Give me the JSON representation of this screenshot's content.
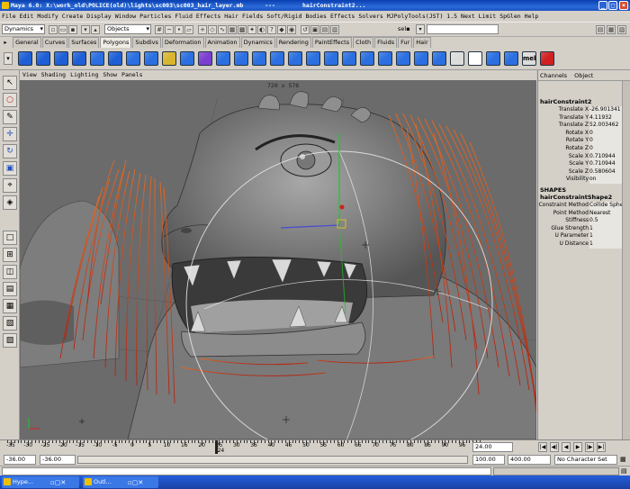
{
  "window": {
    "title": "Maya 6.0: X:\\work_old\\POLICE(old)\\lights\\sc003\\sc003_hair_layer.mb    ---    hairConstraint2...",
    "title_main": "Maya 6.0: X:\\work_old\\POLICE(old)\\lights\\sc003\\sc003_hair_layer.mb",
    "title_sep": "---",
    "title_node": "hairConstraint2..."
  },
  "menus": [
    "File",
    "Edit",
    "Modify",
    "Create",
    "Display",
    "Window",
    "Particles",
    "Fluid Effects",
    "Hair",
    "Fields",
    "Soft/Rigid Bodies",
    "Effects",
    "Solvers",
    "MJPolyTools(JST) 1.5",
    "Next Limit",
    "SpGlen",
    "Help"
  ],
  "statusline": {
    "menuset": "Dynamics",
    "selection_mode": "Objects",
    "sel_label": "sel▪"
  },
  "shelf_tabs": [
    "General",
    "Curves",
    "Surfaces",
    "Polygons",
    "Subdivs",
    "Deformation",
    "Animation",
    "Dynamics",
    "Rendering",
    "PaintEffects",
    "Cloth",
    "Fluids",
    "Fur",
    "Hair"
  ],
  "shelf_active": "Polygons",
  "shelf_icons": [
    {
      "name": "poly-sphere-icon",
      "color": "#1f5fd6"
    },
    {
      "name": "poly-cube-icon",
      "color": "#1f5fd6"
    },
    {
      "name": "poly-cylinder-icon",
      "color": "#1f5fd6"
    },
    {
      "name": "poly-cone-icon",
      "color": "#1f5fd6"
    },
    {
      "name": "poly-plane-icon",
      "color": "#2a6ee0"
    },
    {
      "name": "poly-torus-icon",
      "color": "#1f5fd6"
    },
    {
      "name": "poly-combine-icon",
      "color": "#2b6fe0"
    },
    {
      "name": "poly-separate-icon",
      "color": "#2b6fe0"
    },
    {
      "name": "poly-extract-icon",
      "color": "#d8b430"
    },
    {
      "name": "poly-bool-icon",
      "color": "#2b6fe0"
    },
    {
      "name": "poly-smooth-icon",
      "color": "#7a3fd0"
    },
    {
      "name": "poly-reduce-icon",
      "color": "#2b6fe0"
    },
    {
      "name": "poly-mirror-icon",
      "color": "#2b6fe0"
    },
    {
      "name": "poly-extrude-face-icon",
      "color": "#2b6fe0"
    },
    {
      "name": "poly-extrude-edge-icon",
      "color": "#2b6fe0"
    },
    {
      "name": "poly-bevel-icon",
      "color": "#2b6fe0"
    },
    {
      "name": "poly-split-icon",
      "color": "#2b6fe0"
    },
    {
      "name": "poly-subdivide-icon",
      "color": "#2b6fe0"
    },
    {
      "name": "poly-collapse-icon",
      "color": "#2b6fe0"
    },
    {
      "name": "poly-wedge-icon",
      "color": "#2b6fe0"
    },
    {
      "name": "poly-duplicate-icon",
      "color": "#2b6fe0"
    },
    {
      "name": "poly-merge-icon",
      "color": "#2b6fe0"
    },
    {
      "name": "poly-soften-icon",
      "color": "#2b6fe0"
    },
    {
      "name": "poly-normals-icon",
      "color": "#2b6fe0"
    },
    {
      "name": "uv-editor-icon",
      "color": "#dcdcdc"
    },
    {
      "name": "checker-icon",
      "color": "#ffffff"
    },
    {
      "name": "uv-unfold-icon",
      "color": "#2b6fe0"
    },
    {
      "name": "poly-append-icon",
      "color": "#2b6fe0"
    },
    {
      "name": "mel-script-icon",
      "color": "#dcdcdc"
    },
    {
      "name": "render-icon",
      "color": "#d02020"
    }
  ],
  "tools": [
    {
      "name": "select-tool-icon",
      "glyph": "↖"
    },
    {
      "name": "lasso-tool-icon",
      "glyph": "○"
    },
    {
      "name": "paint-select-tool-icon",
      "glyph": "✎"
    },
    {
      "name": "move-tool-icon",
      "glyph": "✛"
    },
    {
      "name": "rotate-tool-icon",
      "glyph": "↻"
    },
    {
      "name": "scale-tool-icon",
      "glyph": "▣"
    },
    {
      "name": "manipulator-tool-icon",
      "glyph": "⌖"
    },
    {
      "name": "last-tool-icon",
      "glyph": "◈"
    },
    {
      "name": "single-perspective-layout-icon",
      "glyph": "□"
    },
    {
      "name": "four-view-layout-icon",
      "glyph": "⊞"
    },
    {
      "name": "persp-outliner-layout-icon",
      "glyph": "◫"
    },
    {
      "name": "persp-graph-layout-icon",
      "glyph": "▤"
    },
    {
      "name": "hypershade-layout-icon",
      "glyph": "▦"
    },
    {
      "name": "render-layout-icon",
      "glyph": "▧"
    },
    {
      "name": "script-editor-layout-icon",
      "glyph": "▨"
    }
  ],
  "viewport": {
    "menus": [
      "View",
      "Shading",
      "Lighting",
      "Show",
      "Panels"
    ],
    "resolution_gate": "720 x 576"
  },
  "channelbox": {
    "header": [
      "Channels",
      "Object"
    ],
    "node": "hairConstraint2",
    "channels": [
      {
        "label": "Translate X",
        "value": "-26.901341"
      },
      {
        "label": "Translate Y",
        "value": "4.11932"
      },
      {
        "label": "Translate Z",
        "value": "52.003462"
      },
      {
        "label": "Rotate X",
        "value": "0"
      },
      {
        "label": "Rotate Y",
        "value": "0"
      },
      {
        "label": "Rotate Z",
        "value": "0"
      },
      {
        "label": "Scale X",
        "value": "0.710944"
      },
      {
        "label": "Scale Y",
        "value": "0.710944"
      },
      {
        "label": "Scale Z",
        "value": "0.580604"
      },
      {
        "label": "Visibility",
        "value": "on"
      }
    ],
    "shapes_header": "SHAPES",
    "shape_node": "hairConstraintShape2",
    "shape_channels": [
      {
        "label": "Constraint Method",
        "value": "Collide Sphe"
      },
      {
        "label": "Point Method",
        "value": "Nearest"
      },
      {
        "label": "Stiffness",
        "value": "0.5"
      },
      {
        "label": "Glue Strength",
        "value": "1"
      },
      {
        "label": "U Parameter",
        "value": "1"
      },
      {
        "label": "U Distance",
        "value": "1"
      }
    ]
  },
  "timeslider": {
    "ticks": [
      "-35",
      "-30",
      "-25",
      "-20",
      "-15",
      "-10",
      "-5",
      "0",
      "5",
      "10",
      "15",
      "20",
      "25",
      "30",
      "35",
      "40",
      "45",
      "50",
      "55",
      "60",
      "65",
      "70",
      "75",
      "80",
      "85",
      "90",
      "95",
      "100"
    ],
    "tick_values": [
      -35,
      -30,
      -25,
      -20,
      -15,
      -10,
      -5,
      0,
      5,
      10,
      15,
      20,
      25,
      30,
      35,
      40,
      45,
      50,
      55,
      60,
      65,
      70,
      75,
      80,
      85,
      90,
      95,
      100
    ],
    "range_min": -36,
    "range_max": 100,
    "current_frame": "24.00",
    "current_marker": "24",
    "current_value": 24,
    "buttons": [
      "|◀",
      "◀|",
      "◀",
      "▶",
      "|▶",
      "▶|"
    ]
  },
  "rangeslider": {
    "start": "-36.00",
    "inner_start": "-36.00",
    "inner_end": "100.00",
    "end": "400.00",
    "character_set": "No Character Set"
  },
  "taskbar": {
    "items": [
      "Hype...",
      "Outl..."
    ]
  },
  "colors": {
    "titlebar": "#1b52c4",
    "hair": "#e04a10",
    "viewport_bg": "#6e6e6e",
    "monster": "#8a8a8a",
    "selection_green": "#1ec82a"
  }
}
